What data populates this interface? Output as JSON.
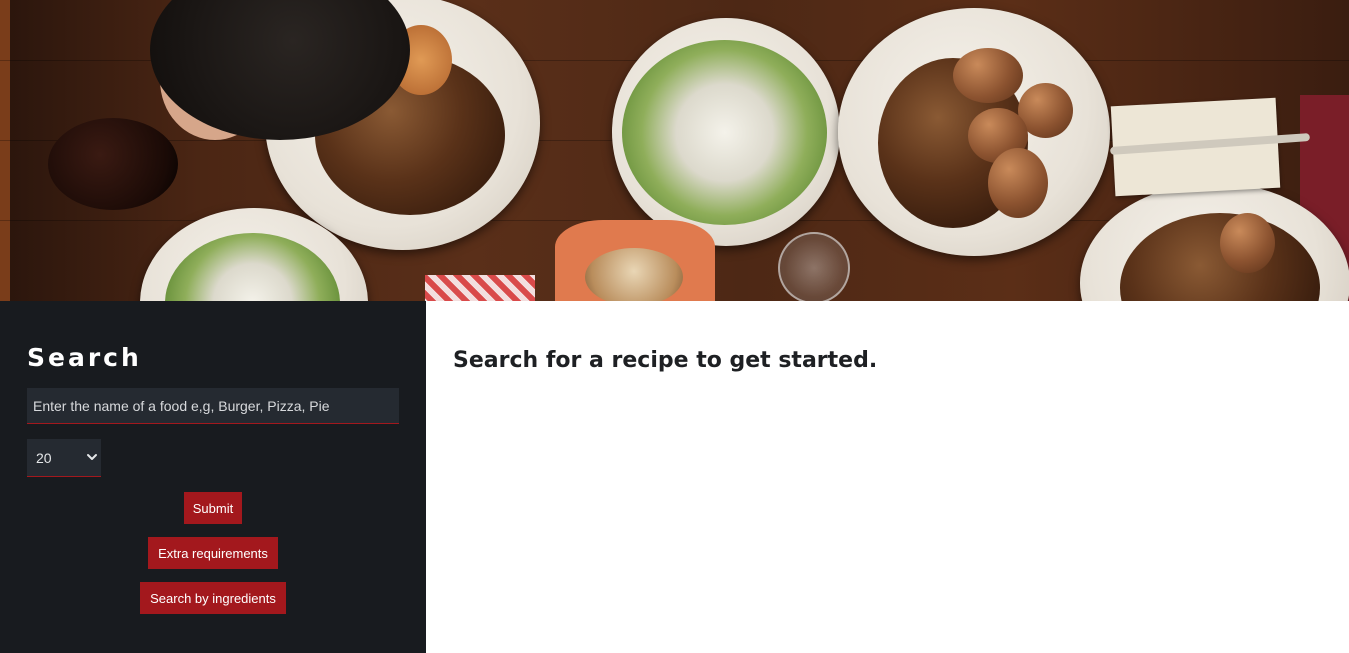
{
  "hero": {
    "image": "hero-food-table-image"
  },
  "sidebar": {
    "title": "Search",
    "search_input": {
      "placeholder": "Enter the name of a food e,g, Burger, Pizza, Pie",
      "value": ""
    },
    "count_select": {
      "selected": "20",
      "icon": "chevron-down-icon"
    },
    "buttons": {
      "submit": "Submit",
      "extra_requirements": "Extra requirements",
      "search_by_ingredients": "Search by ingredients"
    }
  },
  "main": {
    "message": "Search for a recipe to get started."
  },
  "colors": {
    "sidebar_bg": "#181b1f",
    "input_bg": "#252a31",
    "accent": "#a3181d",
    "main_bg": "#ffffff",
    "text_dark": "#1e2023"
  }
}
